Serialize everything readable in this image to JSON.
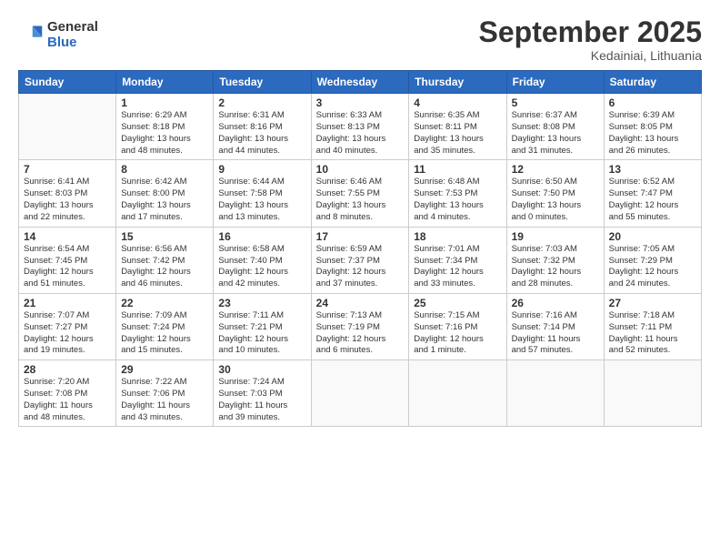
{
  "logo": {
    "general": "General",
    "blue": "Blue"
  },
  "title": "September 2025",
  "location": "Kedainiai, Lithuania",
  "days_of_week": [
    "Sunday",
    "Monday",
    "Tuesday",
    "Wednesday",
    "Thursday",
    "Friday",
    "Saturday"
  ],
  "weeks": [
    [
      {
        "day": "",
        "info": ""
      },
      {
        "day": "1",
        "info": "Sunrise: 6:29 AM\nSunset: 8:18 PM\nDaylight: 13 hours\nand 48 minutes."
      },
      {
        "day": "2",
        "info": "Sunrise: 6:31 AM\nSunset: 8:16 PM\nDaylight: 13 hours\nand 44 minutes."
      },
      {
        "day": "3",
        "info": "Sunrise: 6:33 AM\nSunset: 8:13 PM\nDaylight: 13 hours\nand 40 minutes."
      },
      {
        "day": "4",
        "info": "Sunrise: 6:35 AM\nSunset: 8:11 PM\nDaylight: 13 hours\nand 35 minutes."
      },
      {
        "day": "5",
        "info": "Sunrise: 6:37 AM\nSunset: 8:08 PM\nDaylight: 13 hours\nand 31 minutes."
      },
      {
        "day": "6",
        "info": "Sunrise: 6:39 AM\nSunset: 8:05 PM\nDaylight: 13 hours\nand 26 minutes."
      }
    ],
    [
      {
        "day": "7",
        "info": "Sunrise: 6:41 AM\nSunset: 8:03 PM\nDaylight: 13 hours\nand 22 minutes."
      },
      {
        "day": "8",
        "info": "Sunrise: 6:42 AM\nSunset: 8:00 PM\nDaylight: 13 hours\nand 17 minutes."
      },
      {
        "day": "9",
        "info": "Sunrise: 6:44 AM\nSunset: 7:58 PM\nDaylight: 13 hours\nand 13 minutes."
      },
      {
        "day": "10",
        "info": "Sunrise: 6:46 AM\nSunset: 7:55 PM\nDaylight: 13 hours\nand 8 minutes."
      },
      {
        "day": "11",
        "info": "Sunrise: 6:48 AM\nSunset: 7:53 PM\nDaylight: 13 hours\nand 4 minutes."
      },
      {
        "day": "12",
        "info": "Sunrise: 6:50 AM\nSunset: 7:50 PM\nDaylight: 13 hours\nand 0 minutes."
      },
      {
        "day": "13",
        "info": "Sunrise: 6:52 AM\nSunset: 7:47 PM\nDaylight: 12 hours\nand 55 minutes."
      }
    ],
    [
      {
        "day": "14",
        "info": "Sunrise: 6:54 AM\nSunset: 7:45 PM\nDaylight: 12 hours\nand 51 minutes."
      },
      {
        "day": "15",
        "info": "Sunrise: 6:56 AM\nSunset: 7:42 PM\nDaylight: 12 hours\nand 46 minutes."
      },
      {
        "day": "16",
        "info": "Sunrise: 6:58 AM\nSunset: 7:40 PM\nDaylight: 12 hours\nand 42 minutes."
      },
      {
        "day": "17",
        "info": "Sunrise: 6:59 AM\nSunset: 7:37 PM\nDaylight: 12 hours\nand 37 minutes."
      },
      {
        "day": "18",
        "info": "Sunrise: 7:01 AM\nSunset: 7:34 PM\nDaylight: 12 hours\nand 33 minutes."
      },
      {
        "day": "19",
        "info": "Sunrise: 7:03 AM\nSunset: 7:32 PM\nDaylight: 12 hours\nand 28 minutes."
      },
      {
        "day": "20",
        "info": "Sunrise: 7:05 AM\nSunset: 7:29 PM\nDaylight: 12 hours\nand 24 minutes."
      }
    ],
    [
      {
        "day": "21",
        "info": "Sunrise: 7:07 AM\nSunset: 7:27 PM\nDaylight: 12 hours\nand 19 minutes."
      },
      {
        "day": "22",
        "info": "Sunrise: 7:09 AM\nSunset: 7:24 PM\nDaylight: 12 hours\nand 15 minutes."
      },
      {
        "day": "23",
        "info": "Sunrise: 7:11 AM\nSunset: 7:21 PM\nDaylight: 12 hours\nand 10 minutes."
      },
      {
        "day": "24",
        "info": "Sunrise: 7:13 AM\nSunset: 7:19 PM\nDaylight: 12 hours\nand 6 minutes."
      },
      {
        "day": "25",
        "info": "Sunrise: 7:15 AM\nSunset: 7:16 PM\nDaylight: 12 hours\nand 1 minute."
      },
      {
        "day": "26",
        "info": "Sunrise: 7:16 AM\nSunset: 7:14 PM\nDaylight: 11 hours\nand 57 minutes."
      },
      {
        "day": "27",
        "info": "Sunrise: 7:18 AM\nSunset: 7:11 PM\nDaylight: 11 hours\nand 52 minutes."
      }
    ],
    [
      {
        "day": "28",
        "info": "Sunrise: 7:20 AM\nSunset: 7:08 PM\nDaylight: 11 hours\nand 48 minutes."
      },
      {
        "day": "29",
        "info": "Sunrise: 7:22 AM\nSunset: 7:06 PM\nDaylight: 11 hours\nand 43 minutes."
      },
      {
        "day": "30",
        "info": "Sunrise: 7:24 AM\nSunset: 7:03 PM\nDaylight: 11 hours\nand 39 minutes."
      },
      {
        "day": "",
        "info": ""
      },
      {
        "day": "",
        "info": ""
      },
      {
        "day": "",
        "info": ""
      },
      {
        "day": "",
        "info": ""
      }
    ]
  ]
}
